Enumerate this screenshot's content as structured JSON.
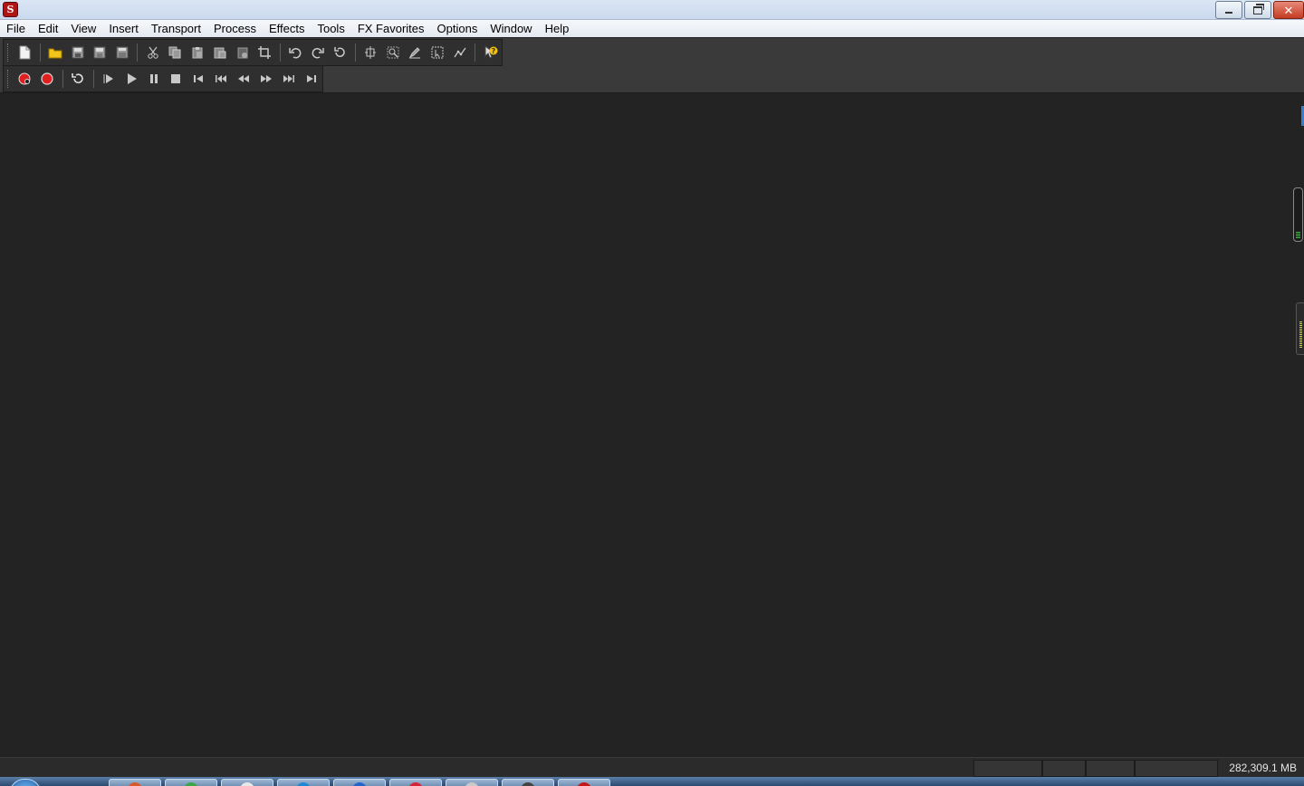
{
  "window": {
    "app_icon_glyph": "S",
    "minimize_icon": "minimize-icon",
    "maximize_icon": "restore-icon",
    "close_icon": "close-icon",
    "close_glyph": "✕"
  },
  "menu": [
    {
      "id": "file",
      "label": "File"
    },
    {
      "id": "edit",
      "label": "Edit"
    },
    {
      "id": "view",
      "label": "View"
    },
    {
      "id": "insert",
      "label": "Insert"
    },
    {
      "id": "transport",
      "label": "Transport"
    },
    {
      "id": "process",
      "label": "Process"
    },
    {
      "id": "effects",
      "label": "Effects"
    },
    {
      "id": "tools",
      "label": "Tools"
    },
    {
      "id": "fx-favorites",
      "label": "FX Favorites"
    },
    {
      "id": "options",
      "label": "Options"
    },
    {
      "id": "window",
      "label": "Window"
    },
    {
      "id": "help",
      "label": "Help"
    }
  ],
  "toolbar_main": [
    "new-file-icon",
    "|",
    "open-folder-icon",
    "save-icon",
    "save-as-icon",
    "save-all-icon",
    "|",
    "cut-icon",
    "copy-icon",
    "paste-icon",
    "paste-special-icon",
    "mix-paste-icon",
    "crop-icon",
    "|",
    "undo-icon",
    "redo-icon",
    "repeat-icon",
    "|",
    "edit-tool-icon",
    "magnify-tool-icon",
    "pencil-tool-icon",
    "select-tool-icon",
    "envelope-tool-icon",
    "|",
    "whats-this-help-icon"
  ],
  "toolbar_transport": [
    "record-arm-icon",
    "record-icon",
    "|",
    "loop-icon",
    "|",
    "play-from-cursor-icon",
    "play-icon",
    "pause-icon",
    "stop-icon",
    "go-to-start-icon",
    "previous-marker-icon",
    "rewind-icon",
    "fast-forward-icon",
    "next-marker-icon",
    "go-to-end-icon"
  ],
  "status": {
    "free_space": "282,309.1 MB"
  },
  "colors": {
    "workspace_bg": "#232323",
    "toolbar_bg": "#3a3a3a",
    "record_red": "#e02020",
    "folder_yellow": "#f2c318",
    "help_yellow": "#f4c20d"
  }
}
